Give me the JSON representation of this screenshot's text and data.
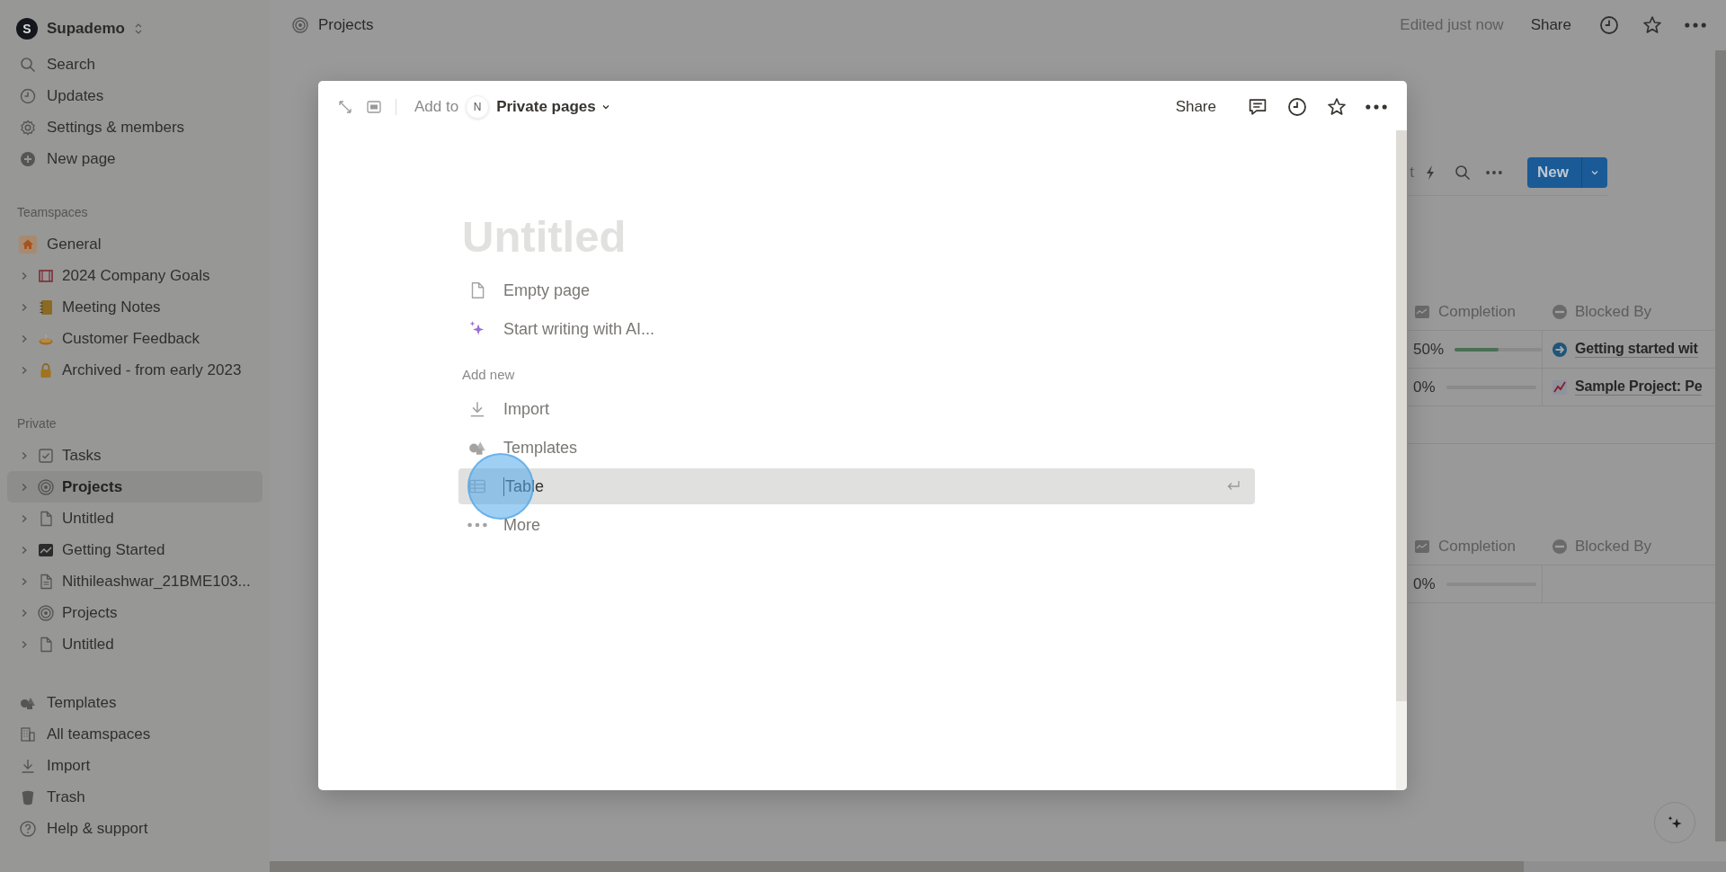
{
  "sidebar": {
    "workspace": {
      "initial": "S",
      "name": "Supademo"
    },
    "nav": [
      {
        "label": "Search"
      },
      {
        "label": "Updates"
      },
      {
        "label": "Settings & members"
      },
      {
        "label": "New page"
      }
    ],
    "teamspaces": {
      "label": "Teamspaces",
      "items": [
        {
          "label": "General",
          "selected": false
        },
        {
          "label": "2024 Company Goals",
          "expanded": false,
          "selected": false
        },
        {
          "label": "Meeting Notes",
          "expanded": false,
          "selected": false
        },
        {
          "label": "Customer Feedback",
          "expanded": false,
          "selected": false
        },
        {
          "label": "Archived - from early 2023",
          "expanded": false,
          "selected": false
        }
      ]
    },
    "private": {
      "label": "Private",
      "items": [
        {
          "label": "Tasks",
          "expanded": false,
          "selected": false
        },
        {
          "label": "Projects",
          "expanded": false,
          "selected": true
        },
        {
          "label": "Untitled",
          "expanded": false,
          "selected": false
        },
        {
          "label": "Getting Started",
          "expanded": false,
          "selected": false
        },
        {
          "label": "Nithileashwar_21BME103...",
          "expanded": false,
          "selected": false
        },
        {
          "label": "Projects",
          "expanded": false,
          "selected": false
        },
        {
          "label": "Untitled",
          "expanded": false,
          "selected": false
        }
      ]
    },
    "bottom": [
      {
        "label": "Templates"
      },
      {
        "label": "All teamspaces"
      },
      {
        "label": "Import"
      },
      {
        "label": "Trash"
      },
      {
        "label": "Help & support"
      }
    ]
  },
  "topbar": {
    "breadcrumb": "Projects",
    "edited": "Edited just now",
    "share": "Share"
  },
  "db_toolbar": {
    "fragment": "t",
    "new_button": "New"
  },
  "tables": [
    {
      "columns": [
        "Completion",
        "Blocked By"
      ],
      "rows": [
        {
          "percent": "50%",
          "level": 0.5,
          "blocked_by": "Getting started wit"
        },
        {
          "percent": "0%",
          "level": 0,
          "blocked_by": "Sample Project: Pe"
        },
        null
      ]
    },
    {
      "columns": [
        "Completion",
        "Blocked By"
      ],
      "rows": [
        {
          "percent": "0%",
          "level": 0,
          "blocked_by": null
        }
      ]
    }
  ],
  "modal": {
    "add_to": "Add to",
    "avatar": "N",
    "location": "Private pages",
    "share": "Share",
    "title_placeholder": "Untitled",
    "starters": [
      {
        "label": "Empty page"
      },
      {
        "label": "Start writing with AI..."
      }
    ],
    "add_new_label": "Add new",
    "add_new": [
      {
        "label": "Import",
        "selected": false
      },
      {
        "label": "Templates",
        "selected": false
      },
      {
        "label": "Table",
        "selected": true
      },
      {
        "label": "More",
        "selected": false
      }
    ]
  }
}
